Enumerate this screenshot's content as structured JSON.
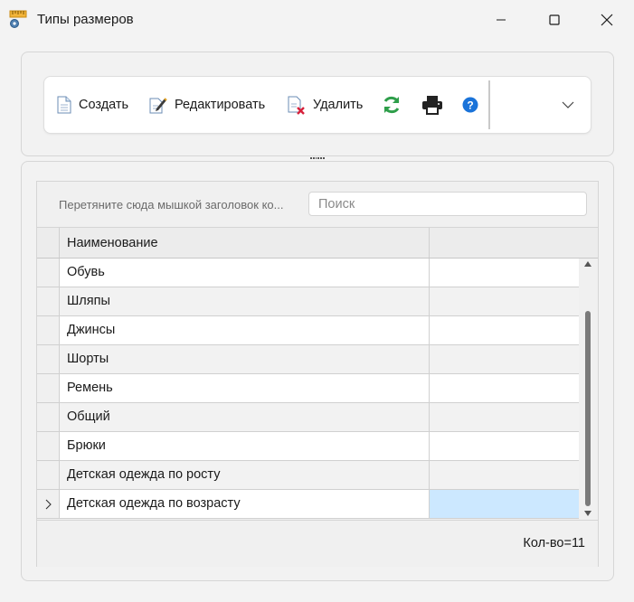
{
  "window": {
    "title": "Типы размеров",
    "icon": "ruler-gear-icon"
  },
  "toolbar": {
    "create_label": "Создать",
    "edit_label": "Редактировать",
    "delete_label": "Удалить",
    "refresh_icon": "refresh-icon",
    "print_icon": "printer-icon",
    "help_icon": "help-icon",
    "more_icon": "chevron-down-icon"
  },
  "grid": {
    "group_hint": "Перетяните сюда мышкой заголовок ко...",
    "search_placeholder": "Поиск",
    "columns": [
      "Наименование",
      ""
    ],
    "rows": [
      {
        "name": "Обувь"
      },
      {
        "name": "Шляпы"
      },
      {
        "name": "Джинсы"
      },
      {
        "name": "Шорты"
      },
      {
        "name": "Ремень"
      },
      {
        "name": "Общий"
      },
      {
        "name": "Брюки"
      },
      {
        "name": "Детская одежда по росту"
      },
      {
        "name": "Детская одежда по возрасту"
      }
    ],
    "selected_row": 8,
    "footer_count": "Кол-во=11"
  },
  "colors": {
    "selection": "#cce8ff",
    "refresh": "#2e9e4a",
    "help": "#1a73d9"
  }
}
